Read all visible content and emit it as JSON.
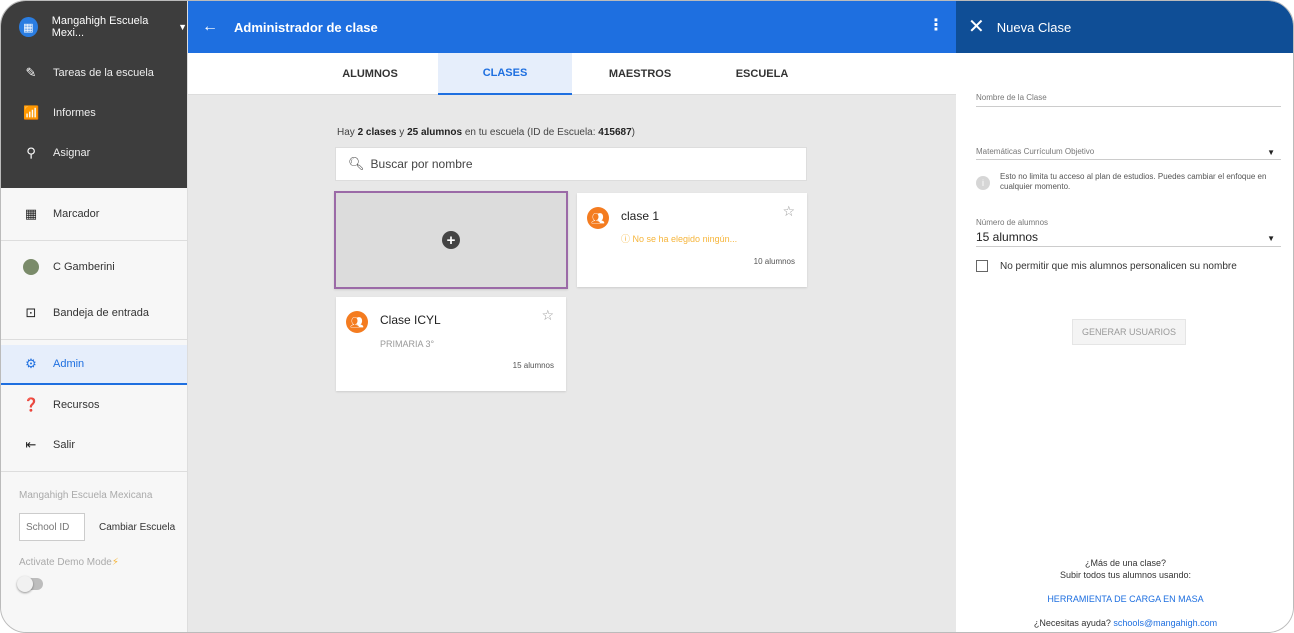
{
  "sidebar": {
    "school_badge": "▦",
    "school_name": "Mangahigh Escuela Mexi...",
    "top_items": [
      {
        "label": "Tareas de la escuela",
        "icon": "edit-icon"
      },
      {
        "label": "Informes",
        "icon": "reports-icon"
      },
      {
        "label": "Asignar",
        "icon": "search-icon"
      }
    ],
    "items": [
      {
        "label": "Marcador",
        "icon": "scoreboard-icon"
      },
      {
        "label": "C Gamberini",
        "icon": "avatar"
      },
      {
        "label": "Bandeja de entrada",
        "icon": "inbox-icon"
      },
      {
        "label": "Admin",
        "icon": "admin-icon",
        "active": true
      },
      {
        "label": "Recursos",
        "icon": "help-icon"
      },
      {
        "label": "Salir",
        "icon": "logout-icon"
      }
    ],
    "school_label": "Mangahigh Escuela Mexicana",
    "school_id_placeholder": "School ID",
    "change_school": "Cambiar Escuela",
    "demo_mode": "Activate Demo Mode",
    "demo_enabled": false
  },
  "header": {
    "title": "Administrador de clase"
  },
  "tabs": [
    {
      "label": "ALUMNOS",
      "active": false
    },
    {
      "label": "CLASES",
      "active": true
    },
    {
      "label": "MAESTROS",
      "active": false
    },
    {
      "label": "ESCUELA",
      "active": false
    }
  ],
  "summary": {
    "prefix": "Hay ",
    "classes": "2 clases",
    "mid": " y ",
    "students": "25 alumnos",
    "suffix": " en tu escuela (ID de Escuela: ",
    "school_id": "415687",
    "close": ")"
  },
  "search": {
    "placeholder": "Buscar por nombre"
  },
  "classes": [
    {
      "name": "clase 1",
      "warning": "No se ha elegido ningún...",
      "count": "10 alumnos"
    },
    {
      "name": "Clase ICYL",
      "subtitle": "PRIMARIA 3°",
      "count": "15 alumnos"
    }
  ],
  "panel": {
    "title": "Nueva Clase",
    "name_label": "Nombre de la Clase",
    "curriculum_label": "Matemáticas Currículum Objetivo",
    "info_text": "Esto no limita tu acceso al plan de estudios. Puedes cambiar el enfoque en cualquier momento.",
    "students_label": "Número de alumnos",
    "students_value": "15 alumnos",
    "checkbox_label": "No permitir que mis alumnos personalicen su nombre",
    "checkbox_checked": false,
    "generate_button": "GENERAR USUARIOS",
    "bulk_question": "¿Más de una clase?",
    "bulk_hint": "Subir todos tus alumnos usando:",
    "bulk_link": "HERRAMIENTA DE CARGA EN MASA",
    "help_text": "¿Necesitas ayuda?",
    "help_email": "schools@mangahigh.com"
  },
  "colors": {
    "primary": "#1e6fe0",
    "panel_header": "#0f4e96",
    "sidebar_dark": "#3d3d3d",
    "class_icon": "#f47c20",
    "warning": "#f6b53b"
  }
}
